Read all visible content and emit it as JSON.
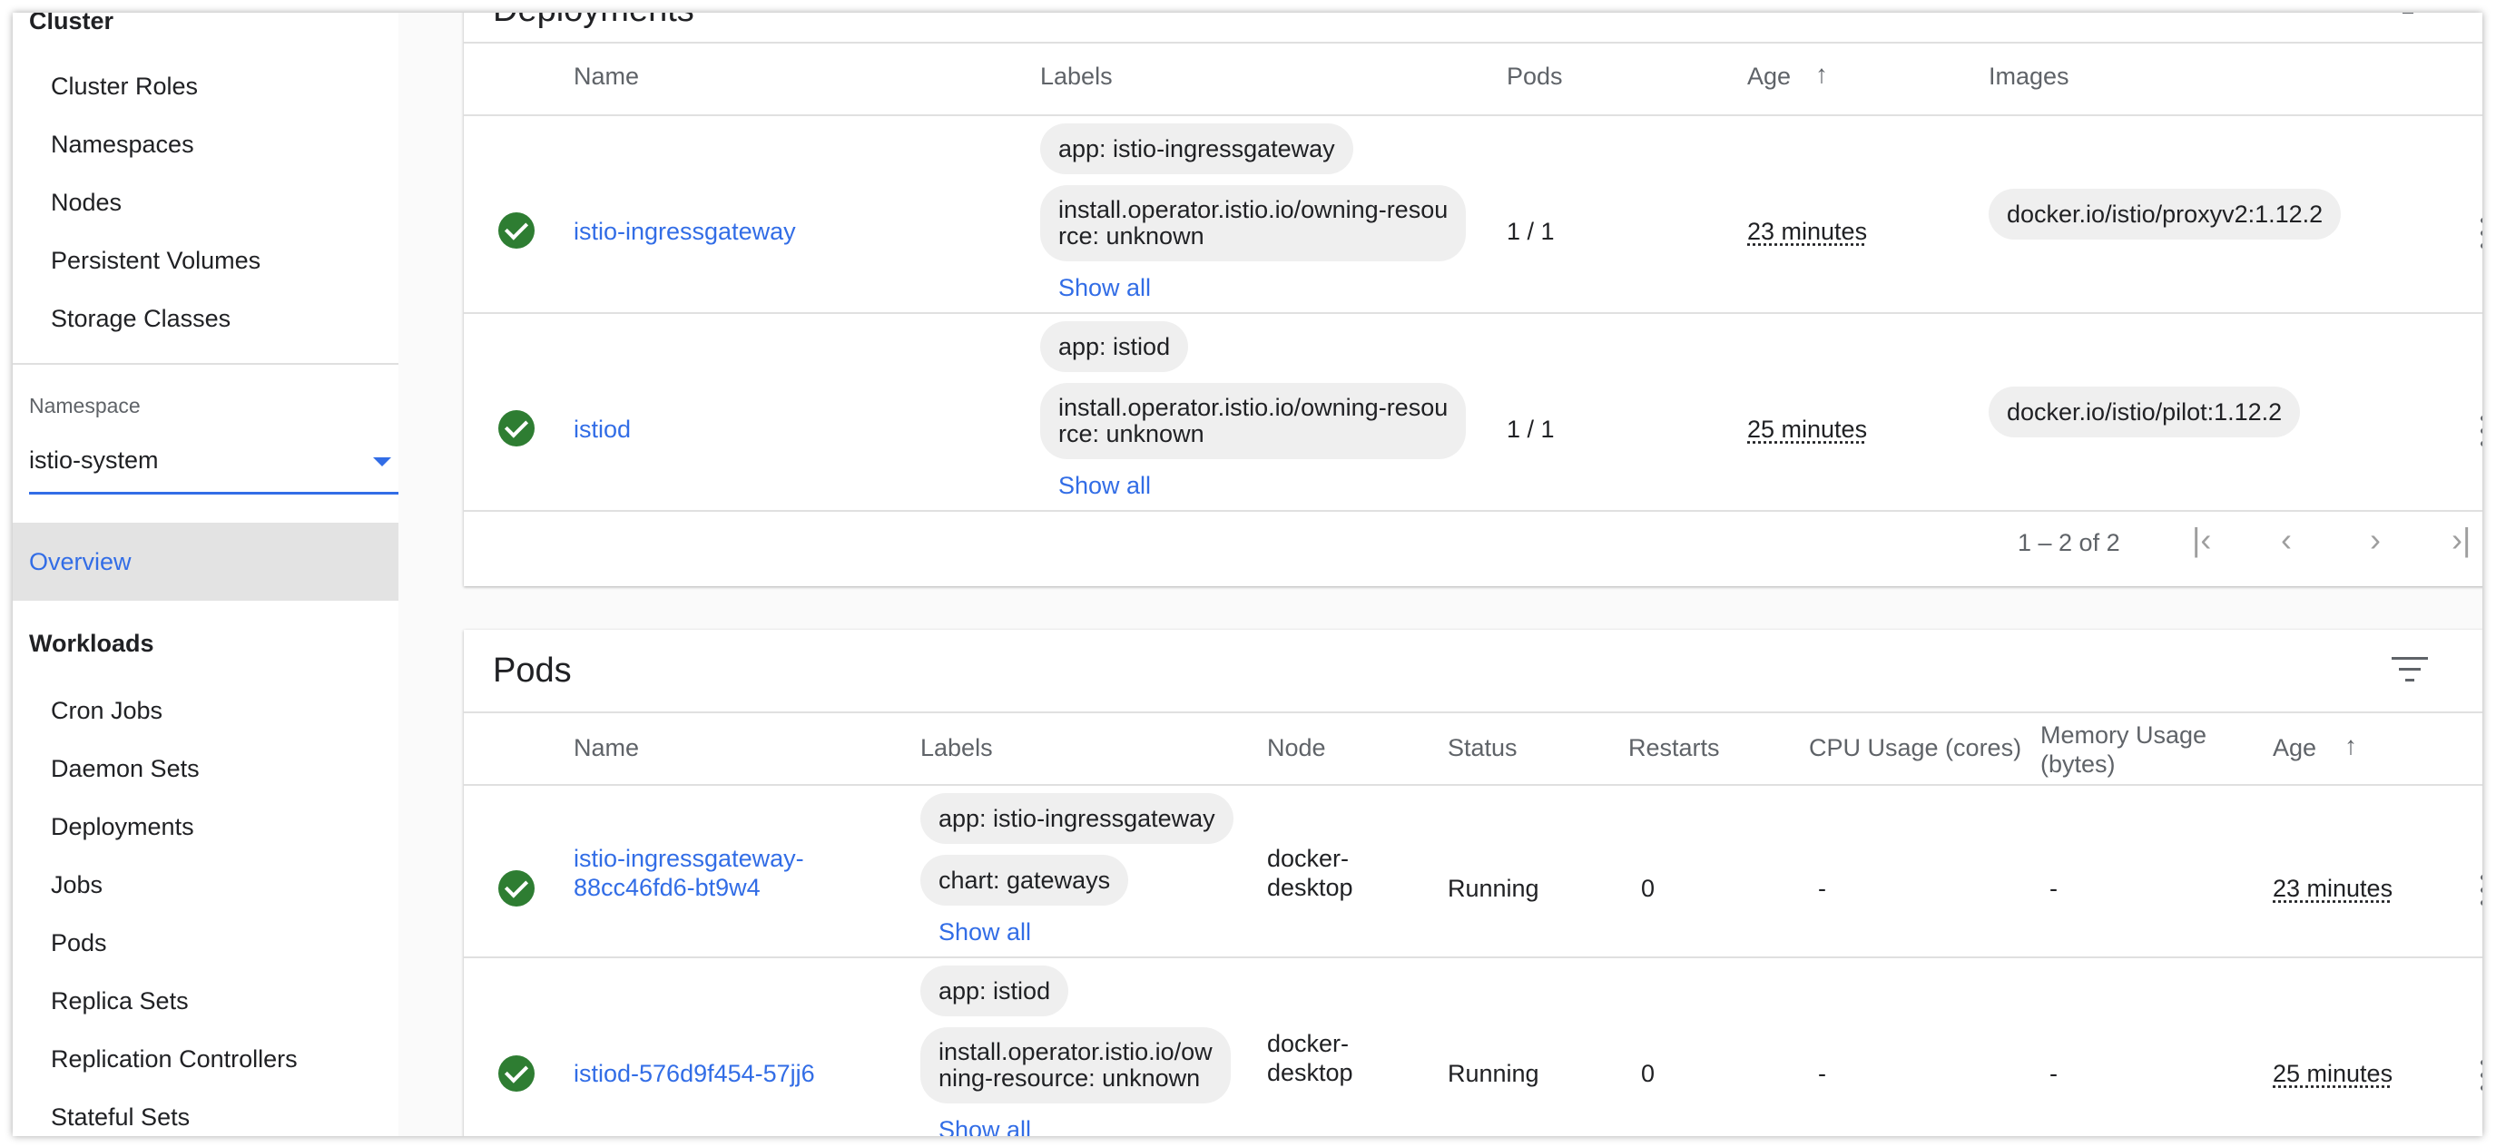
{
  "sidebar": {
    "cluster_title": "Cluster",
    "cluster_items": [
      "Cluster Roles",
      "Namespaces",
      "Nodes",
      "Persistent Volumes",
      "Storage Classes"
    ],
    "namespace_label": "Namespace",
    "namespace_value": "istio-system",
    "overview": "Overview",
    "workloads_title": "Workloads",
    "workload_items": [
      "Cron Jobs",
      "Daemon Sets",
      "Deployments",
      "Jobs",
      "Pods",
      "Replica Sets",
      "Replication Controllers",
      "Stateful Sets"
    ]
  },
  "deployments": {
    "title": "Deployments",
    "columns": {
      "name": "Name",
      "labels": "Labels",
      "pods": "Pods",
      "age": "Age",
      "images": "Images"
    },
    "rows": [
      {
        "status": "running",
        "name": "istio-ingressgateway",
        "labels": [
          "app: istio-ingressgateway",
          "install.operator.istio.io/owning-resou\nrce: unknown"
        ],
        "show_all": "Show all",
        "pods": "1 / 1",
        "age": "23 minutes",
        "image": "docker.io/istio/proxyv2:1.12.2"
      },
      {
        "status": "running",
        "name": "istiod",
        "labels": [
          "app: istiod",
          "install.operator.istio.io/owning-resou\nrce: unknown"
        ],
        "show_all": "Show all",
        "pods": "1 / 1",
        "age": "25 minutes",
        "image": "docker.io/istio/pilot:1.12.2"
      }
    ],
    "pagination": "1 – 2 of 2"
  },
  "pods": {
    "title": "Pods",
    "columns": {
      "name": "Name",
      "labels": "Labels",
      "node": "Node",
      "status": "Status",
      "restarts": "Restarts",
      "cpu": "CPU Usage (cores)",
      "memory": "Memory Usage\n(bytes)",
      "age": "Age"
    },
    "rows": [
      {
        "status_icon": "running",
        "name": "istio-ingressgateway-\n88cc46fd6-bt9w4",
        "labels": [
          "app: istio-ingressgateway",
          "chart: gateways"
        ],
        "show_all": "Show all",
        "node": "docker-\ndesktop",
        "status": "Running",
        "restarts": "0",
        "cpu": "-",
        "memory": "-",
        "age": "23 minutes"
      },
      {
        "status_icon": "running",
        "name": "istiod-576d9f454-57jj6",
        "labels": [
          "app: istiod",
          "install.operator.istio.io/ow\nning-resource: unknown"
        ],
        "show_all": "Show all",
        "node": "docker-\ndesktop",
        "status": "Running",
        "restarts": "0",
        "cpu": "-",
        "memory": "-",
        "age": "25 minutes"
      }
    ]
  },
  "icons": {
    "sort_asc": "arrow-upward-icon",
    "row_status": "check-circle-icon",
    "row_menu": "more-vert-icon",
    "filter": "filter-list-icon",
    "pager": [
      "first-page-icon",
      "chevron-left-icon",
      "chevron-right-icon",
      "last-page-icon"
    ]
  },
  "colors": {
    "accent": "#326de6",
    "success": "#2e7d32",
    "chip_bg": "#efefef"
  }
}
